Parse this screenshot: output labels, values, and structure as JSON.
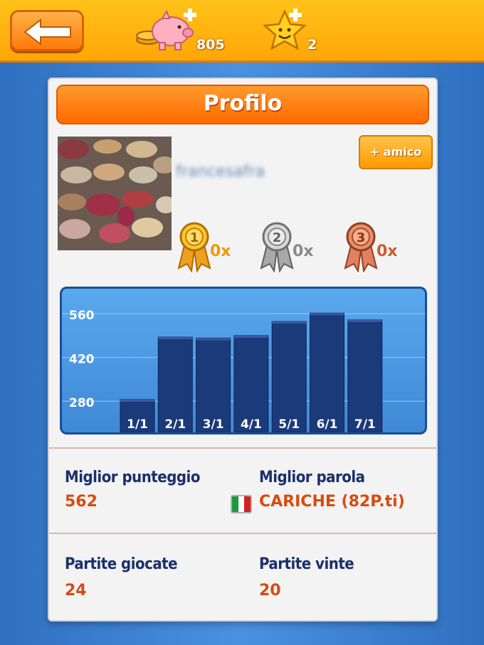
{
  "topbar": {
    "back_icon": "arrow-left-icon",
    "coins": {
      "icon": "piggy-bank-icon",
      "value": "805"
    },
    "stars": {
      "icon": "star-icon",
      "value": "2"
    }
  },
  "profile": {
    "title": "Profilo",
    "username": "francesafra",
    "add_friend_label": "+ amico",
    "medals": [
      {
        "icon": "gold-medal-icon",
        "number": "1",
        "count": "0x",
        "color": "#f09a00"
      },
      {
        "icon": "silver-medal-icon",
        "number": "2",
        "count": "0x",
        "color": "#8a8a8a"
      },
      {
        "icon": "bronze-medal-icon",
        "number": "3",
        "count": "0x",
        "color": "#d05a30"
      }
    ]
  },
  "chart_data": {
    "type": "bar",
    "categories": [
      "1/1",
      "2/1",
      "3/1",
      "4/1",
      "5/1",
      "6/1",
      "7/1"
    ],
    "values": [
      285,
      485,
      482,
      490,
      535,
      562,
      540
    ],
    "yticks": [
      280,
      420,
      560
    ],
    "ylim": [
      180,
      640
    ],
    "grid": true,
    "title": "",
    "xlabel": "",
    "ylabel": ""
  },
  "stats": {
    "best_score_label": "Miglior punteggio",
    "best_score_value": "562",
    "best_word_label": "Miglior parola",
    "best_word_value": "CARICHE (82P.ti)",
    "games_played_label": "Partite giocate",
    "games_played_value": "24",
    "games_won_label": "Partite vinte",
    "games_won_value": "20"
  },
  "colors": {
    "bar": "#1a3a7a",
    "accent_orange": "#ff6a00",
    "stat_value": "#d84b10",
    "stat_label": "#1b2f6b"
  }
}
